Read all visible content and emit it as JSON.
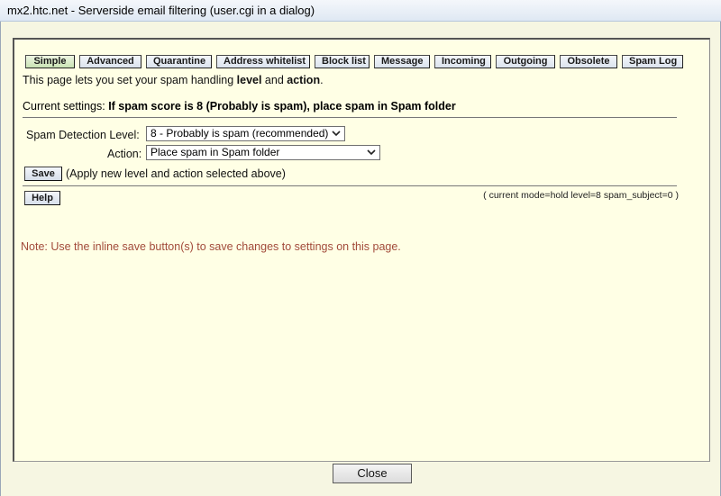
{
  "window": {
    "title": "mx2.htc.net - Serverside email filtering (user.cgi in a dialog)"
  },
  "tabs": [
    {
      "label": "Simple",
      "active": true
    },
    {
      "label": "Advanced"
    },
    {
      "label": "Quarantine"
    },
    {
      "label": "Address whitelist"
    },
    {
      "label": "Block list"
    },
    {
      "label": "Message"
    },
    {
      "label": "Incoming"
    },
    {
      "label": "Outgoing"
    },
    {
      "label": "Obsolete"
    },
    {
      "label": "Spam Log"
    }
  ],
  "intro": {
    "prefix": "This page lets you set your spam handling ",
    "level": "level",
    "and": " and ",
    "action": "action",
    "suffix": "."
  },
  "current": {
    "label": "Current settings: ",
    "value": "If spam score is 8 (Probably is spam), place spam in Spam folder"
  },
  "form": {
    "level_label": "Spam Detection Level:",
    "level_value": "8 - Probably is spam (recommended)",
    "action_label": "Action:",
    "action_value": "Place spam in Spam folder",
    "save_label": "Save",
    "save_hint": "(Apply new level and action selected above)",
    "help_label": "Help",
    "mode_text": "( current mode=hold level=8 spam_subject=0 )"
  },
  "note": "Note: Use the inline save button(s) to save changes to settings on this page.",
  "footer": {
    "close_label": "Close"
  }
}
